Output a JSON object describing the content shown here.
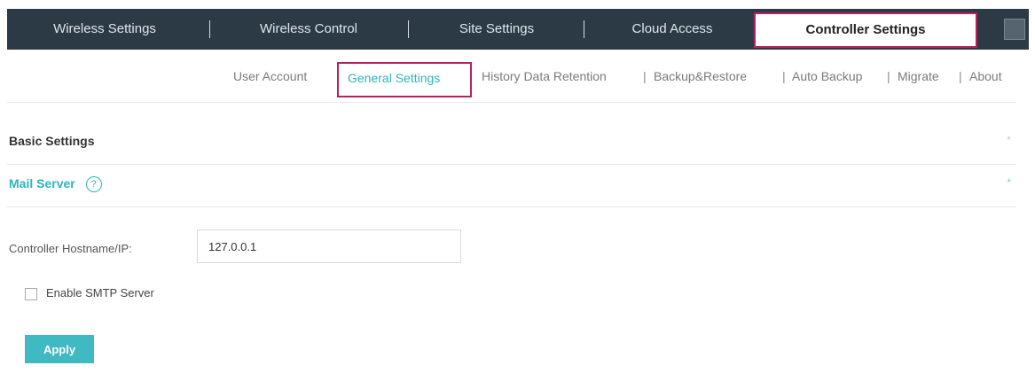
{
  "top_tabs": [
    {
      "label": "Wireless Settings"
    },
    {
      "label": "Wireless Control"
    },
    {
      "label": "Site Settings"
    },
    {
      "label": "Cloud Access"
    },
    {
      "label": "Controller Settings",
      "active": true
    }
  ],
  "sub_nav": {
    "items": [
      "User Account",
      "General Settings",
      "History Data Retention",
      "Backup&Restore",
      "Auto Backup",
      "Migrate",
      "About"
    ],
    "active": "General Settings"
  },
  "sections": {
    "basic": {
      "title": "Basic Settings",
      "toggle": "*"
    },
    "mail": {
      "title": "Mail Server",
      "help": "?",
      "toggle": "*"
    }
  },
  "form": {
    "hostname_label": "Controller Hostname/IP:",
    "hostname_value": "127.0.0.1",
    "smtp_label": "Enable SMTP Server",
    "smtp_checked": false,
    "apply_label": "Apply"
  },
  "colors": {
    "accent": "#3fb9c2",
    "highlight": "#b5235e",
    "topbar": "#2c3a45"
  }
}
